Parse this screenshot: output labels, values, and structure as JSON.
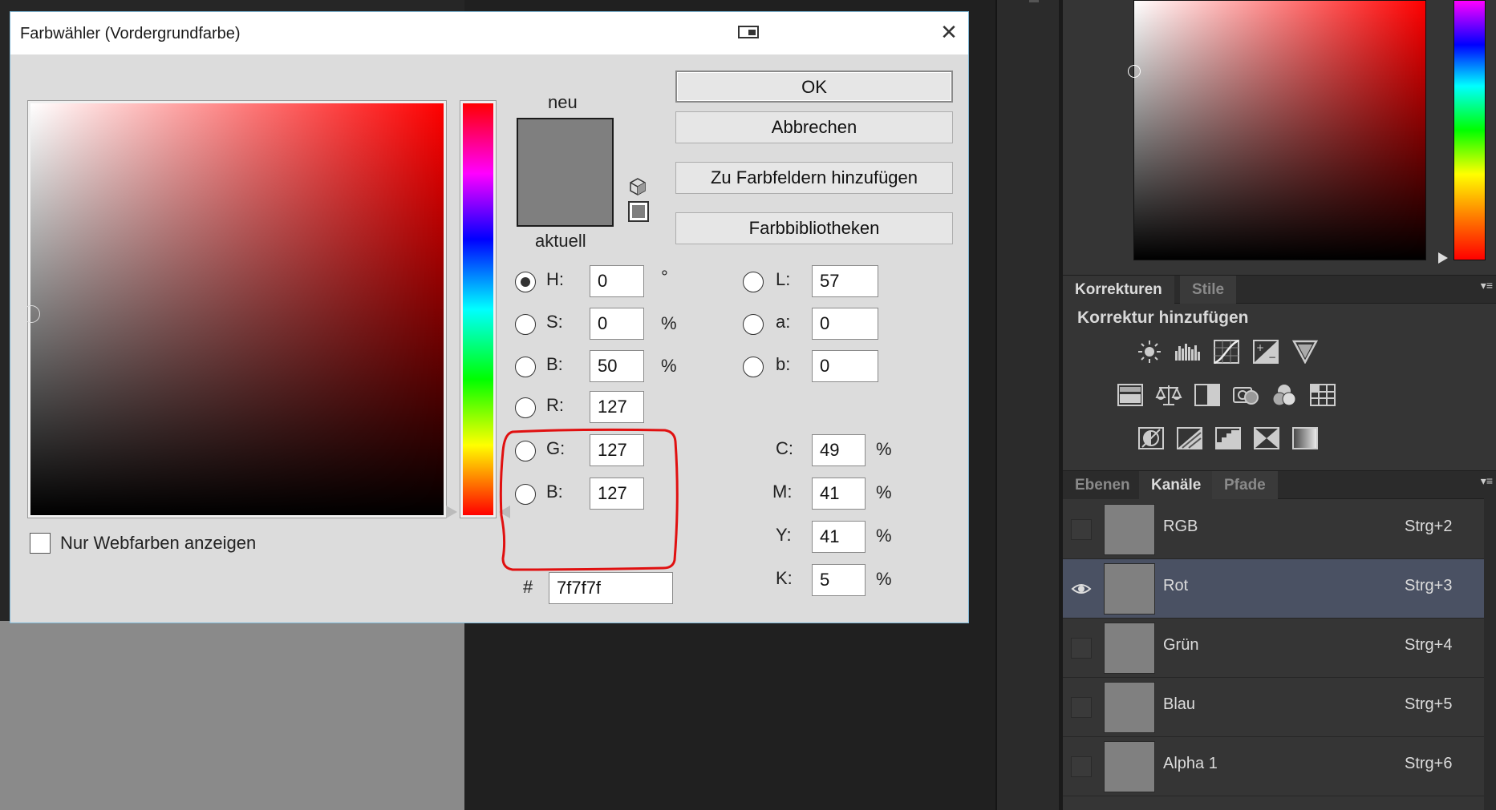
{
  "dialog": {
    "title": "Farbwähler (Vordergrundfarbe)",
    "new_label": "neu",
    "current_label": "aktuell",
    "new_color": "#7f7f7f",
    "buttons": {
      "ok": "OK",
      "cancel": "Abbrechen",
      "add_swatches": "Zu Farbfeldern hinzufügen",
      "libraries": "Farbbibliotheken"
    },
    "fields": {
      "H": {
        "label": "H:",
        "value": "0",
        "unit": "°"
      },
      "S": {
        "label": "S:",
        "value": "0",
        "unit": "%"
      },
      "Bhsb": {
        "label": "B:",
        "value": "50",
        "unit": "%"
      },
      "R": {
        "label": "R:",
        "value": "127"
      },
      "G": {
        "label": "G:",
        "value": "127"
      },
      "Brgb": {
        "label": "B:",
        "value": "127"
      },
      "L": {
        "label": "L:",
        "value": "57"
      },
      "a": {
        "label": "a:",
        "value": "0"
      },
      "b": {
        "label": "b:",
        "value": "0"
      },
      "C": {
        "label": "C:",
        "value": "49",
        "unit": "%"
      },
      "M": {
        "label": "M:",
        "value": "41",
        "unit": "%"
      },
      "Y": {
        "label": "Y:",
        "value": "41",
        "unit": "%"
      },
      "K": {
        "label": "K:",
        "value": "5",
        "unit": "%"
      }
    },
    "hex_label": "#",
    "hex_value": "7f7f7f",
    "web_colors_label": "Nur Webfarben anzeigen",
    "annotation_color": "#e01010"
  },
  "adjustments_panel": {
    "tabs": [
      "Korrekturen",
      "Stile"
    ],
    "heading": "Korrektur hinzufügen",
    "icons_row1": [
      "brightness-contrast-icon",
      "levels-icon",
      "curves-icon",
      "exposure-icon",
      "vibrance-icon"
    ],
    "icons_row2": [
      "hue-saturation-icon",
      "color-balance-icon",
      "black-white-icon",
      "photo-filter-icon",
      "channel-mixer-icon",
      "color-lookup-icon"
    ],
    "icons_row3": [
      "invert-icon",
      "posterize-icon",
      "threshold-icon",
      "selective-color-icon",
      "gradient-map-icon"
    ]
  },
  "layers_panel": {
    "tabs": [
      "Ebenen",
      "Kanäle",
      "Pfade"
    ],
    "channels": [
      {
        "name": "RGB",
        "shortcut": "Strg+2"
      },
      {
        "name": "Rot",
        "shortcut": "Strg+3"
      },
      {
        "name": "Grün",
        "shortcut": "Strg+4"
      },
      {
        "name": "Blau",
        "shortcut": "Strg+5"
      },
      {
        "name": "Alpha 1",
        "shortcut": "Strg+6"
      }
    ]
  }
}
